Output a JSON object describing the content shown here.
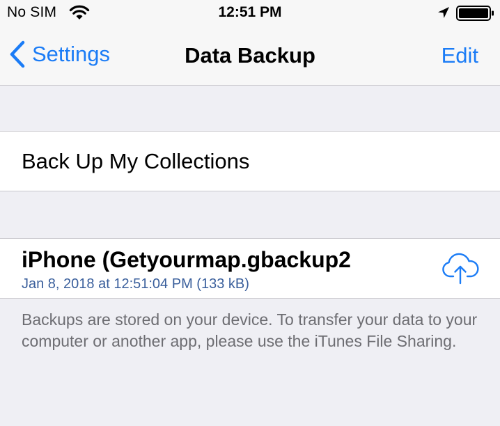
{
  "status_bar": {
    "carrier": "No SIM",
    "time": "12:51 PM",
    "icons": [
      "wifi-icon",
      "location-icon",
      "battery-icon"
    ]
  },
  "nav_bar": {
    "back_label": "Settings",
    "title": "Data Backup",
    "edit_label": "Edit",
    "accent_color": "#1b7cf6"
  },
  "backup_section": {
    "action_label": "Back Up My Collections"
  },
  "backups": [
    {
      "name": "iPhone (Getyourmap.gbackup2",
      "detail": "Jan 8, 2018 at 12:51:04 PM (133 kB)",
      "action_icon": "cloud-upload-icon"
    }
  ],
  "footer": {
    "text": "Backups are stored on your device. To transfer your data to your computer or another app, please use the iTunes File Sharing."
  }
}
